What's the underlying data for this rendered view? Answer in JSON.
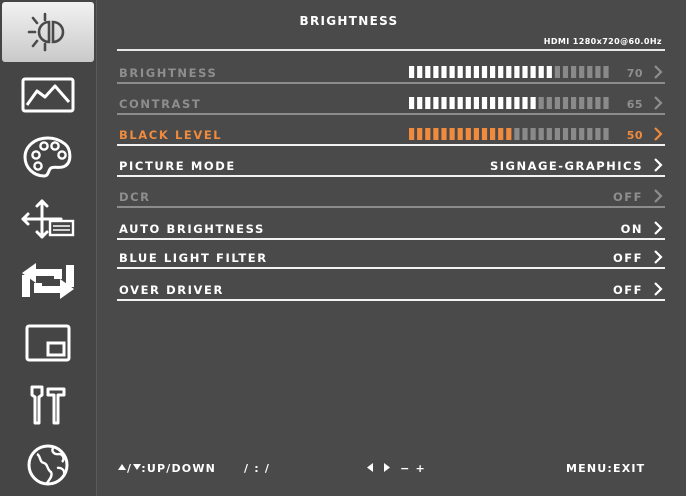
{
  "colors": {
    "background": "#4a4a4a",
    "highlight": "#f08a3c",
    "bar_filled": "#ffffff",
    "bar_empty": "#8a8a8a",
    "bar_hl_filled": "#f08a3c",
    "dim_text": "#8e8e8e"
  },
  "sidebar": {
    "items": [
      {
        "name": "brightness",
        "icon": "brightness-icon",
        "active": true
      },
      {
        "name": "image",
        "icon": "image-icon",
        "active": false
      },
      {
        "name": "color",
        "icon": "palette-icon",
        "active": false
      },
      {
        "name": "input",
        "icon": "input-arrows-icon",
        "active": false
      },
      {
        "name": "signal-switch",
        "icon": "swap-arrows-icon",
        "active": false
      },
      {
        "name": "pip",
        "icon": "pip-icon",
        "active": false
      },
      {
        "name": "system",
        "icon": "tools-icon",
        "active": false
      },
      {
        "name": "language",
        "icon": "globe-icon",
        "active": false
      }
    ]
  },
  "header": {
    "title": "BRIGHTNESS",
    "resolution": "HDMI 1280x720@60.0Hz"
  },
  "menu": {
    "brightness": {
      "label": "BRIGHTNESS",
      "value": "70",
      "level": 70
    },
    "contrast": {
      "label": "CONTRAST",
      "value": "65",
      "level": 65
    },
    "black_level": {
      "label": "BLACK LEVEL",
      "value": "50",
      "level": 50
    },
    "picture_mode": {
      "label": "PICTURE MODE",
      "value": "SIGNAGE-GRAPHICS"
    },
    "dcr": {
      "label": "DCR",
      "value": "OFF"
    },
    "auto_brightness": {
      "label": "AUTO BRIGHTNESS",
      "value": "ON"
    },
    "blue_light": {
      "label": "BLUE LIGHT FILTER",
      "value": "OFF"
    },
    "over_driver": {
      "label": "OVER DRIVER",
      "value": "OFF"
    }
  },
  "footer": {
    "up_down": "UP/DOWN",
    "separators": "/ : /",
    "adjust": "− +",
    "menu_exit": "MENU:EXIT"
  }
}
